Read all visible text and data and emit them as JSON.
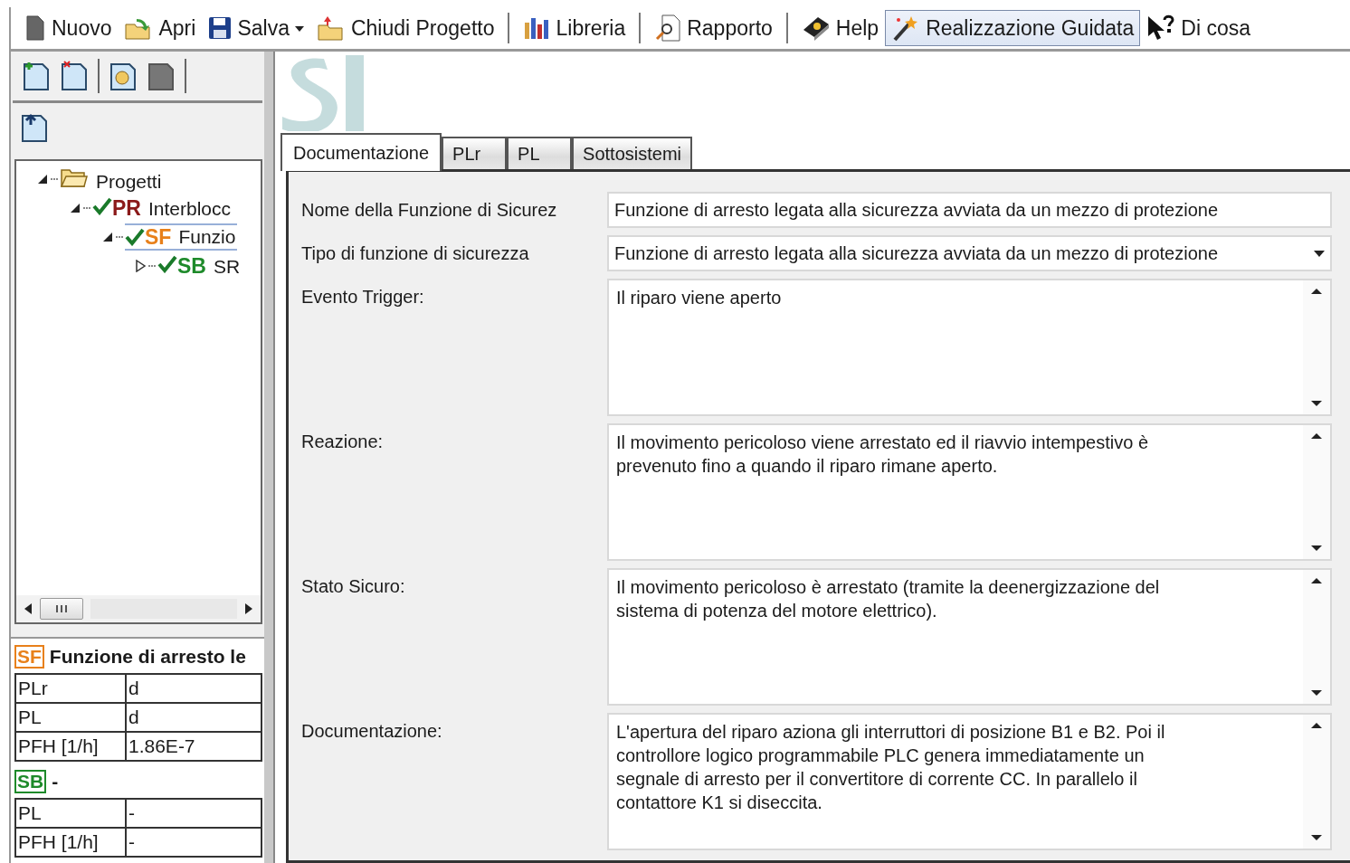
{
  "toolbar": {
    "groups": [
      [
        {
          "label": "Nuovo",
          "dropdown": false,
          "pressed": false
        },
        {
          "label": "Apri",
          "dropdown": false,
          "pressed": false
        },
        {
          "label": "Salva",
          "dropdown": true,
          "pressed": false
        },
        {
          "label": "Chiudi Progetto",
          "dropdown": false,
          "pressed": false
        }
      ],
      [
        {
          "label": "Libreria",
          "dropdown": false,
          "pressed": false
        }
      ],
      [
        {
          "label": "Rapporto",
          "dropdown": false,
          "pressed": false
        }
      ],
      [
        {
          "label": "Help",
          "dropdown": false,
          "pressed": false
        },
        {
          "label": "Realizzazione Guidata",
          "dropdown": false,
          "pressed": true
        },
        {
          "label": "Di cosa",
          "dropdown": false,
          "pressed": false
        }
      ]
    ]
  },
  "sidebar": {
    "tree": [
      {
        "kind": "folder",
        "label": "Progetti",
        "expanded": true,
        "selected": false,
        "children": [
          {
            "kind": "item",
            "badge": "PR",
            "color": "#8b1a1a",
            "label": "Interblocc",
            "checked": true,
            "expanded": true,
            "selected": false,
            "children": [
              {
                "kind": "item",
                "badge": "SF",
                "color": "#e8801a",
                "label": "Funzio",
                "checked": true,
                "expanded": true,
                "selected": true,
                "children": [
                  {
                    "kind": "item",
                    "badge": "SB",
                    "color": "#1e8a2a",
                    "label": "SR",
                    "checked": true,
                    "expanded": false,
                    "selected": false
                  }
                ]
              }
            ]
          }
        ]
      }
    ],
    "summary": [
      {
        "badge": "SF",
        "color": "#e8801a",
        "title": "Funzione di arresto le",
        "rows": [
          {
            "name": "PLr",
            "value": "d"
          },
          {
            "name": "PL",
            "value": "d"
          },
          {
            "name": "PFH [1/h]",
            "value": "1.86E-7"
          }
        ]
      },
      {
        "badge": "SB",
        "color": "#1e8a2a",
        "title": "-",
        "rows": [
          {
            "name": "PL",
            "value": "-"
          },
          {
            "name": "PFH [1/h]",
            "value": "-"
          }
        ]
      }
    ]
  },
  "tabs": [
    {
      "label": "Documentazione",
      "selected": true
    },
    {
      "label": "PLr",
      "selected": false
    },
    {
      "label": "PL",
      "selected": false
    },
    {
      "label": "Sottosistemi",
      "selected": false
    }
  ],
  "form": [
    {
      "kind": "text",
      "label": "Nome della Funzione di Sicurez",
      "value": "Funzione di arresto legata alla sicurezza avviata da un mezzo di protezione"
    },
    {
      "kind": "dropdown",
      "label": "Tipo di funzione di sicurezza",
      "value": "Funzione di arresto legata alla sicurezza avviata da un mezzo di protezione"
    },
    {
      "kind": "textarea",
      "label": "Evento Trigger:",
      "value": "Il riparo viene aperto"
    },
    {
      "kind": "textarea",
      "label": "Reazione:",
      "value": "Il movimento pericoloso viene arrestato ed il riavvio intempestivo è\nprevenuto fino a quando il riparo rimane aperto."
    },
    {
      "kind": "textarea",
      "label": "Stato Sicuro:",
      "value": "Il movimento pericoloso è arrestato (tramite la deenergizzazione del\nsistema di potenza del motore elettrico)."
    },
    {
      "kind": "textarea",
      "label": "Documentazione:",
      "value": "L'apertura del riparo aziona gli interruttori di posizione B1 e B2. Poi il\ncontrollore logico programmabile PLC genera immediatamente un\nsegnale di arresto per il convertitore di corrente CC. In parallelo il\ncontattore K1 si diseccita."
    }
  ]
}
